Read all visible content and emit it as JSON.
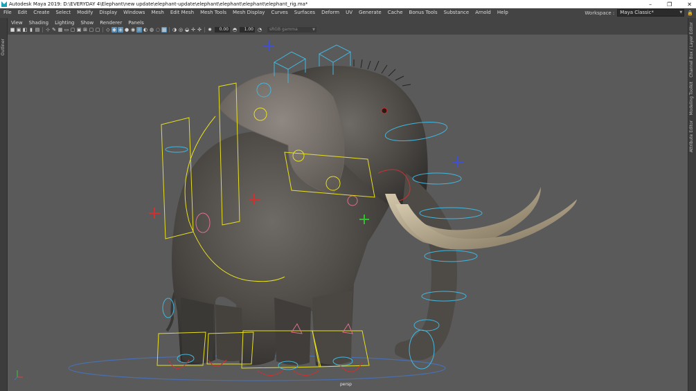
{
  "app": {
    "title": "Autodesk Maya 2019: D:\\EVERYDAY 4\\Elephant\\new update\\elephant-update\\elephant\\elephant\\elephant\\elephant_rig.ma*",
    "window_controls": [
      "–",
      "❐",
      "✕"
    ]
  },
  "menubar": {
    "items": [
      "File",
      "Edit",
      "Create",
      "Select",
      "Modify",
      "Display",
      "Windows",
      "Mesh",
      "Edit Mesh",
      "Mesh Tools",
      "Mesh Display",
      "Curves",
      "Surfaces",
      "Deform",
      "UV",
      "Generate",
      "Cache",
      "Bonus Tools",
      "Substance",
      "Arnold",
      "Help"
    ],
    "workspace_label": "Workspace :",
    "workspace_value": "Maya Classic*"
  },
  "left_panel": {
    "label": "Outliner"
  },
  "right_panel": {
    "labels": [
      "Channel Box / Layer Editor",
      "Modeling Toolkit",
      "Attribute Editor"
    ]
  },
  "panel_menu": {
    "items": [
      "View",
      "Shading",
      "Lighting",
      "Show",
      "Renderer",
      "Panels"
    ]
  },
  "toolbar": {
    "exposure": "0.00",
    "gamma": "1.00",
    "color_space": "sRGB gamma"
  },
  "viewport": {
    "camera": "persp",
    "axis_colors": {
      "x": "#e04040",
      "y": "#40c040",
      "z": "#4070e0"
    },
    "rig_colors": {
      "control_yellow": "#e8e020",
      "control_cyan": "#40b8e0",
      "control_red": "#d03030",
      "control_blue": "#4050d0",
      "control_green": "#30c030",
      "control_pink": "#e07090"
    }
  }
}
